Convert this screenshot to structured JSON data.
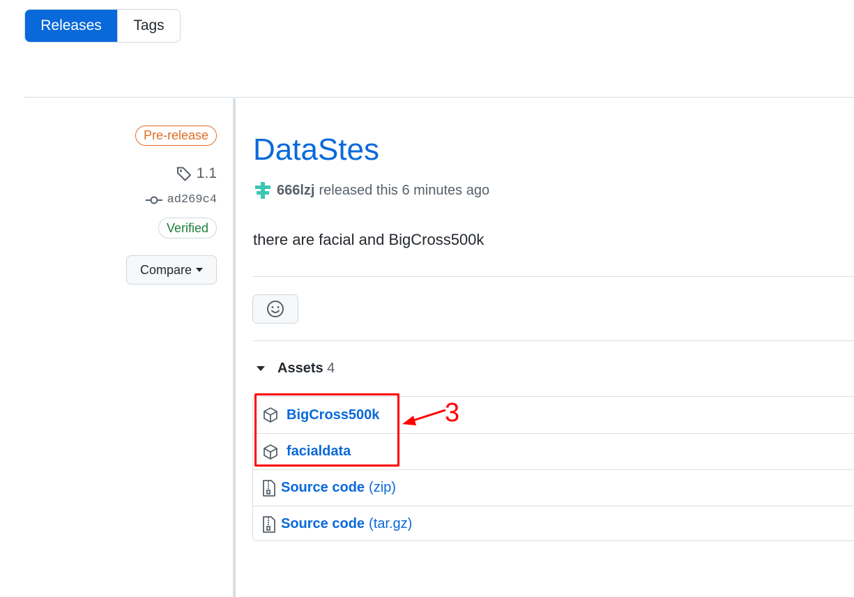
{
  "tabs": [
    {
      "label": "Releases",
      "active": true
    },
    {
      "label": "Tags",
      "active": false
    }
  ],
  "sidebar": {
    "badge": "Pre-release",
    "tag": "1.1",
    "commit": "ad269c4",
    "verified": "Verified",
    "compare": "Compare"
  },
  "release": {
    "title": "DataStes",
    "user": "666lzj",
    "released_text": "released this 6 minutes ago",
    "description": "there are facial and BigCross500k"
  },
  "assets": {
    "label": "Assets",
    "count": "4",
    "items": [
      {
        "name": "BigCross500k",
        "suffix": "",
        "icon": "package-icon"
      },
      {
        "name": "facialdata",
        "suffix": "",
        "icon": "package-icon"
      },
      {
        "name": "Source code",
        "suffix": "(zip)",
        "icon": "file-zip-icon"
      },
      {
        "name": "Source code",
        "suffix": "(tar.gz)",
        "icon": "file-zip-icon"
      }
    ]
  },
  "annotation": {
    "number": "3",
    "color": "#ff0000"
  },
  "colors": {
    "accent": "#0969da",
    "prerelease": "#e16f24",
    "verified": "#1a7f37"
  }
}
